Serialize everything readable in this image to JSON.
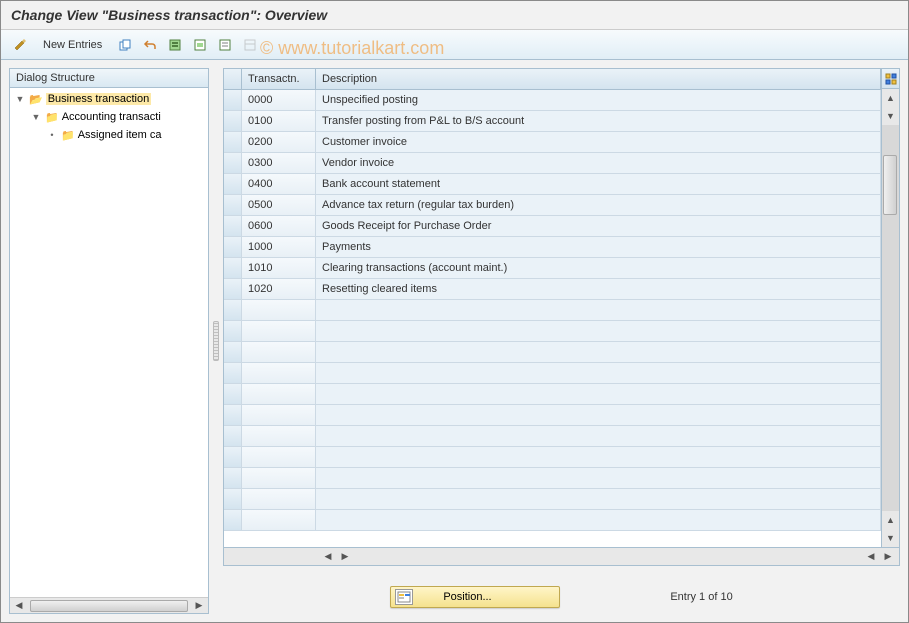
{
  "title": "Change View \"Business transaction\": Overview",
  "watermark": "© www.tutorialkart.com",
  "toolbar": {
    "new_entries_label": "New Entries"
  },
  "sidebar": {
    "header": "Dialog Structure",
    "items": [
      {
        "label": "Business transaction",
        "level": 1,
        "open": true,
        "selected": true
      },
      {
        "label": "Accounting transacti",
        "level": 2,
        "open": false,
        "selected": false
      },
      {
        "label": "Assigned item ca",
        "level": 3,
        "open": false,
        "selected": false
      }
    ]
  },
  "table": {
    "columns": {
      "code": "Transactn.",
      "desc": "Description"
    },
    "rows": [
      {
        "code": "0000",
        "desc": "Unspecified posting"
      },
      {
        "code": "0100",
        "desc": "Transfer posting from P&L to B/S account"
      },
      {
        "code": "0200",
        "desc": "Customer invoice"
      },
      {
        "code": "0300",
        "desc": "Vendor invoice"
      },
      {
        "code": "0400",
        "desc": "Bank account statement"
      },
      {
        "code": "0500",
        "desc": "Advance tax return (regular tax burden)"
      },
      {
        "code": "0600",
        "desc": "Goods Receipt for Purchase Order"
      },
      {
        "code": "1000",
        "desc": "Payments"
      },
      {
        "code": "1010",
        "desc": "Clearing transactions (account maint.)"
      },
      {
        "code": "1020",
        "desc": "Resetting cleared items"
      },
      {
        "code": "",
        "desc": ""
      },
      {
        "code": "",
        "desc": ""
      },
      {
        "code": "",
        "desc": ""
      },
      {
        "code": "",
        "desc": ""
      },
      {
        "code": "",
        "desc": ""
      },
      {
        "code": "",
        "desc": ""
      },
      {
        "code": "",
        "desc": ""
      },
      {
        "code": "",
        "desc": ""
      },
      {
        "code": "",
        "desc": ""
      },
      {
        "code": "",
        "desc": ""
      },
      {
        "code": "",
        "desc": ""
      }
    ]
  },
  "footer": {
    "position_label": "Position...",
    "entry_status": "Entry 1 of 10"
  }
}
